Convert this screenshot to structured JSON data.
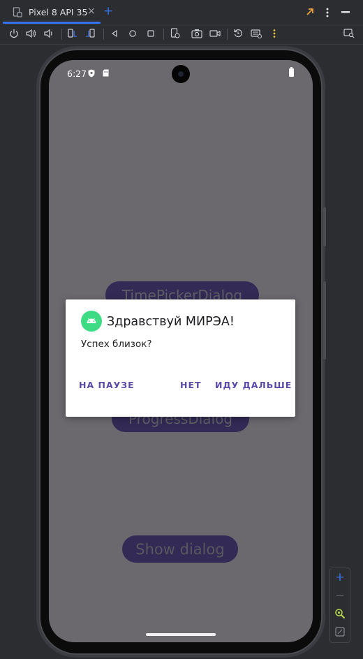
{
  "tabs": {
    "active_label": "Pixel 8 API 35",
    "close_icon": "close-icon",
    "add_icon": "add-tab-icon"
  },
  "window_controls": [
    "expand-arrow-icon",
    "more-vertical-icon",
    "minimize-icon"
  ],
  "toolbar": {
    "buttons": [
      "power-icon",
      "volume-up-icon",
      "volume-down-icon",
      "rotate-left-icon",
      "rotate-right-icon",
      "back-icon",
      "home-icon",
      "overview-icon",
      "snapshot-icon",
      "screenshot-icon",
      "screen-record-icon",
      "reset-icon",
      "keyboard-icon",
      "more-vertical-icon",
      "device-explorer-icon"
    ]
  },
  "device": {
    "status_time": "6:27",
    "status_icons": [
      "shield-icon",
      "sim-card-icon",
      "battery-icon"
    ],
    "background_buttons": {
      "time_picker": "TimePickerDialog",
      "progress": "ProgressDialog",
      "show_dialog": "Show dialog"
    }
  },
  "dialog": {
    "icon": "android-icon",
    "title": "Здравствуй МИРЭА!",
    "message": "Успех близок?",
    "neutral_button": "НА ПАУЗЕ",
    "negative_button": "НЕТ",
    "positive_button": "ИДУ ДАЛЬШЕ"
  },
  "zoom_controls": {
    "zoom_in": "+",
    "zoom_out": "−",
    "icons": [
      "zoom-in-icon",
      "zoom-out-icon",
      "zoom-fit-icon",
      "fit-screen-icon"
    ]
  },
  "colors": {
    "accent": "#3574f0",
    "dialog_button": "#5b4aa8",
    "android_green": "#3ddc84",
    "scrim": "#6b696e"
  }
}
